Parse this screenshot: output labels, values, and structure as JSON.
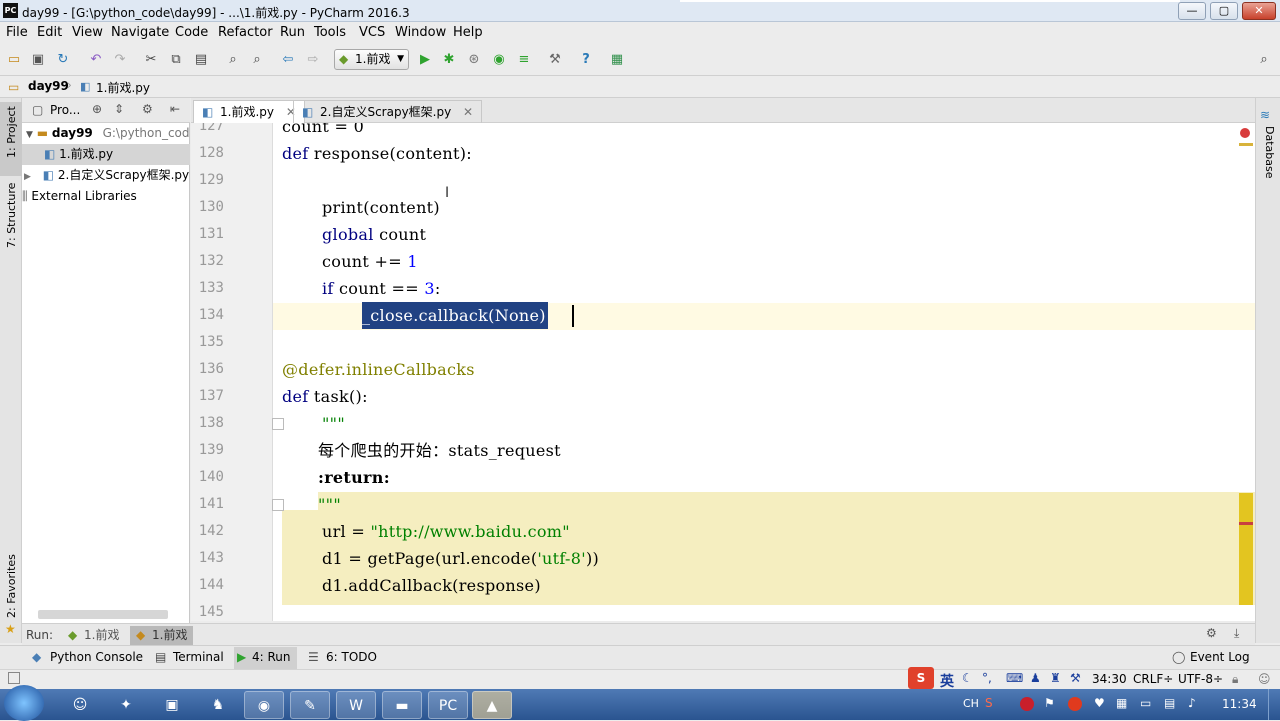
{
  "window": {
    "title": "day99 - [G:\\python_code\\day99] - ...\\1.前戏.py - PyCharm 2016.3",
    "app_icon": "PC",
    "minimize": "—",
    "maximize": "▢",
    "close": "✕"
  },
  "menu": [
    "File",
    "Edit",
    "View",
    "Navigate",
    "Code",
    "Refactor",
    "Run",
    "Tools",
    "VCS",
    "Window",
    "Help"
  ],
  "toolbar": {
    "run_config": "1.前戏"
  },
  "breadcrumb": {
    "project": "day99",
    "file": "1.前戏.py"
  },
  "left_stripe": {
    "project_tab": "1: Project",
    "structure_tab": "7: Structure",
    "favorites_tab": "2: Favorites"
  },
  "right_stripe": {
    "database_tab": "Database"
  },
  "project_panel": {
    "dropdown": "Pro...",
    "tree": [
      {
        "label": "day99",
        "detail": "G:\\python_code\\d",
        "bold": true
      },
      {
        "label": "1.前戏.py",
        "selected": true
      },
      {
        "label": "2.自定义Scrapy框架.py"
      },
      {
        "label": "External Libraries"
      }
    ]
  },
  "tabs": [
    {
      "label": "1.前戏.py",
      "active": true
    },
    {
      "label": "2.自定义Scrapy框架.py",
      "active": false
    }
  ],
  "editor": {
    "line_numbers": [
      "127",
      "128",
      "129",
      "130",
      "131",
      "132",
      "133",
      "134",
      "135",
      "136",
      "137",
      "138",
      "139",
      "140",
      "141",
      "142",
      "143",
      "144",
      "145"
    ],
    "code": {
      "l127": "count = 0",
      "l128_kw": "def",
      "l128_rest": " response(content):",
      "l130": "print(content)",
      "l131_kw": "global",
      "l131_rest": " count",
      "l132_a": "count += ",
      "l132_num": "1",
      "l133_kw": "if",
      "l133_a": " count == ",
      "l133_num": "3",
      "l133_b": ":",
      "l134": "_close.callback(None)",
      "l136": "@defer.inlineCallbacks",
      "l137_kw": "def",
      "l137_rest": " task():",
      "l138": "\"\"\"",
      "l139_cn": "每个爬虫的开始：",
      "l139_rest": "stats_request",
      "l140": ":return:",
      "l141": "\"\"\"",
      "l142_a": "url = ",
      "l142_str": "\"http://www.baidu.com\"",
      "l143_a": "d1 = getPage(url.encode(",
      "l143_str": "'utf-8'",
      "l143_b": "))",
      "l144": "d1.addCallback(response)"
    }
  },
  "run_bar": {
    "label": "Run:",
    "tabs": [
      "1.前戏",
      "1.前戏"
    ]
  },
  "tool_windows": [
    {
      "label": "Python Console"
    },
    {
      "label": "Terminal"
    },
    {
      "label": "4: Run",
      "active": true
    },
    {
      "label": "6: TODO"
    }
  ],
  "event_log": "Event Log",
  "status": {
    "position": "34:30",
    "line_sep": "CRLF÷",
    "encoding": "UTF-8÷",
    "ime_lang": "英",
    "ime_ch": "CH"
  },
  "taskbar": {
    "clock": "11:34"
  },
  "colors": {
    "keyword": "#000080",
    "string": "#008000",
    "decorator": "#808000",
    "selection": "#214283",
    "current_line": "#fffae3",
    "block_highlight": "#f5eec0"
  }
}
